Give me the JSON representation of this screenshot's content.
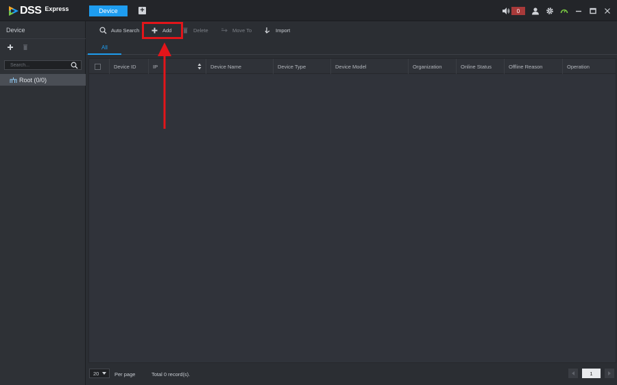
{
  "app": {
    "logo_text": "DSS",
    "logo_sub": "Express",
    "tab_label": "Device",
    "alarm_count": "0",
    "colors": {
      "accent": "#1e9df0",
      "highlight": "#e3151a",
      "alarm": "#a83a3a"
    }
  },
  "sidebar": {
    "title": "Device",
    "search_placeholder": "Search...",
    "tree_root_label": "Root (0/0)"
  },
  "toolbar": {
    "auto_search": "Auto Search",
    "add": "Add",
    "delete": "Delete",
    "move_to": "Move To",
    "import": "Import"
  },
  "subtabs": {
    "all": "All"
  },
  "table": {
    "columns": [
      "Device ID",
      "IP",
      "Device Name",
      "Device Type",
      "Device Model",
      "Organization",
      "Online Status",
      "Offline Reason",
      "Operation"
    ],
    "rows": []
  },
  "footer": {
    "per_page_value": "20",
    "per_page_label": "Per page",
    "total_text": "Total 0 record(s).",
    "page_value": "1"
  }
}
